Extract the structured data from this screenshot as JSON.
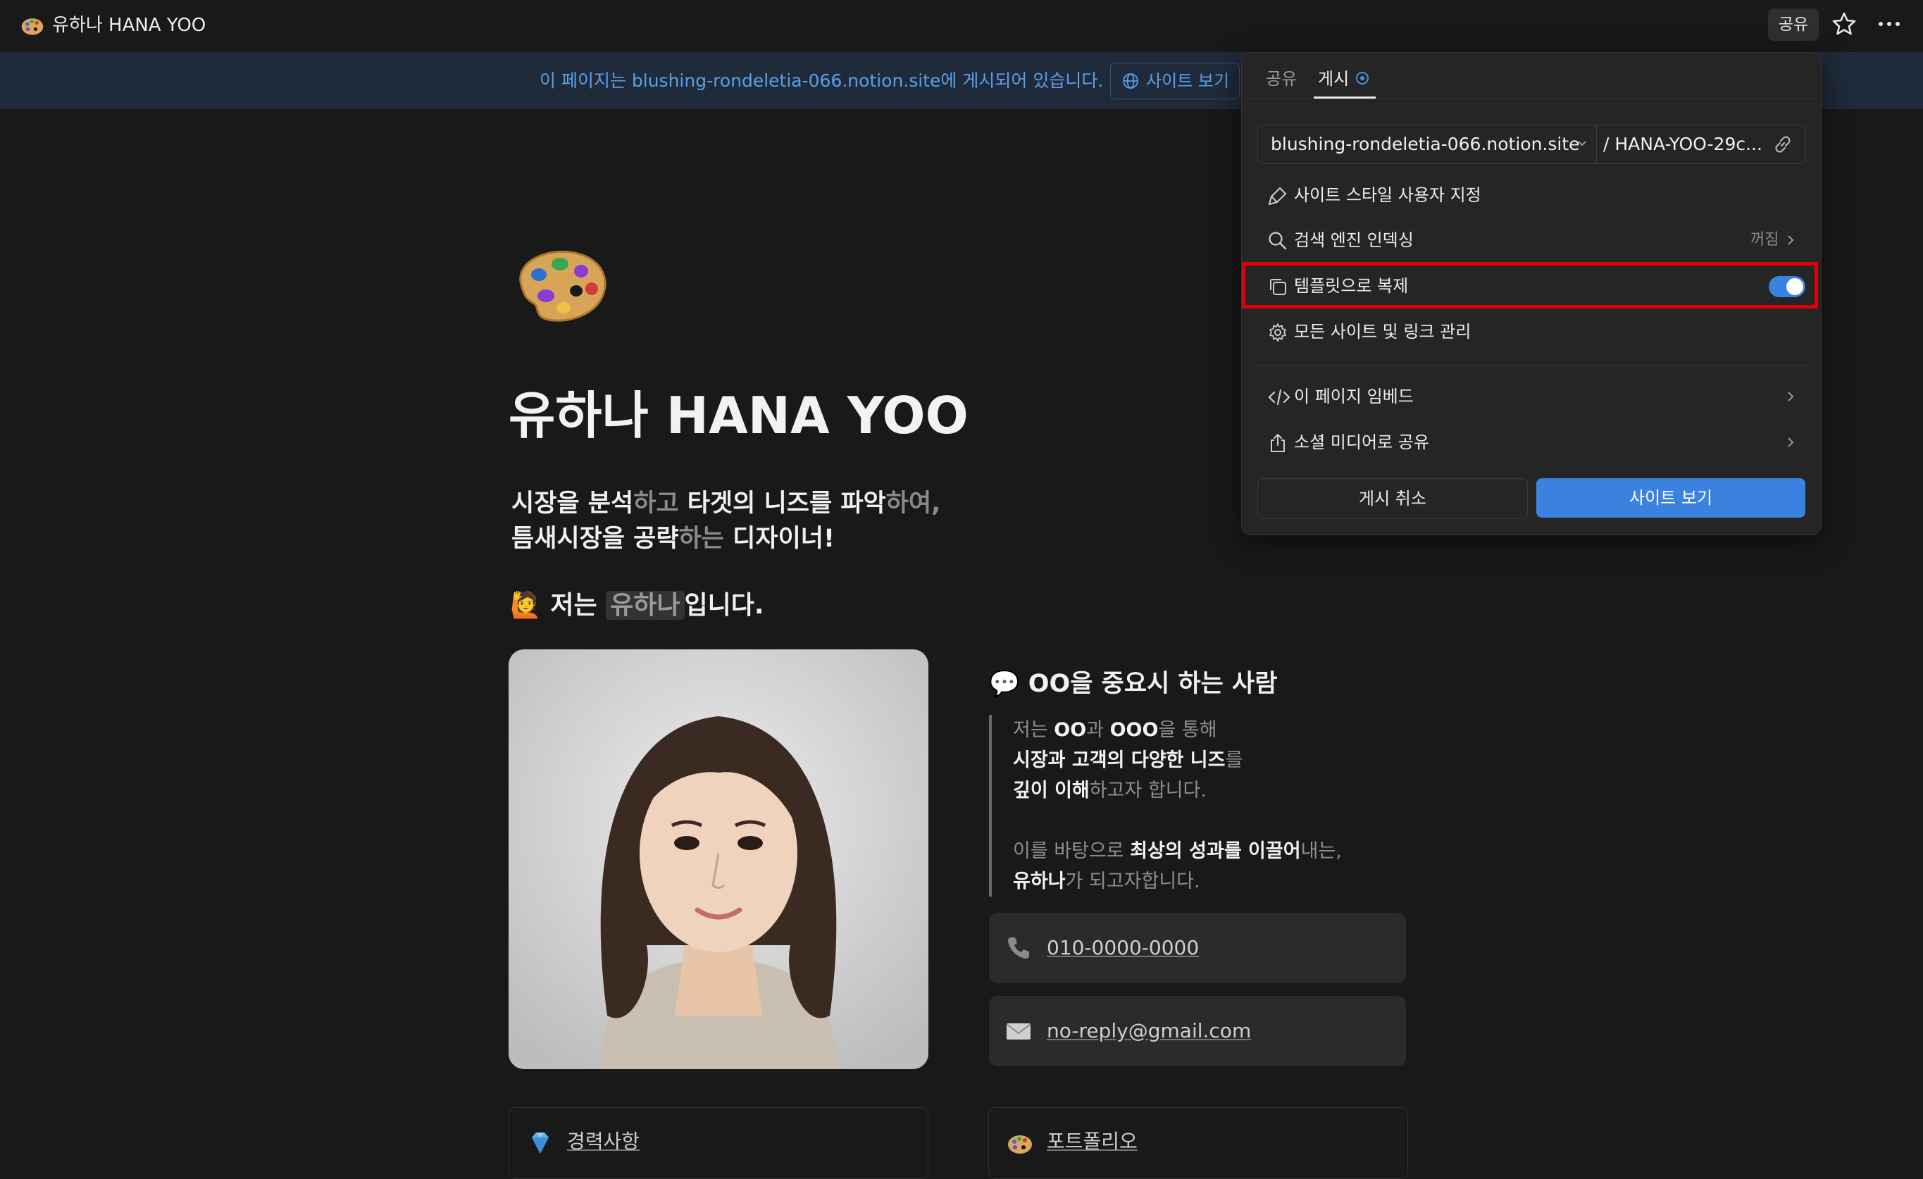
{
  "topbar": {
    "title": "유하나 HANA YOO",
    "share_label": "공유",
    "icons": [
      "palette-icon",
      "star-icon",
      "more-icon"
    ]
  },
  "banner": {
    "text": "이 페이지는 blushing-rondeletia-066.notion.site에 게시되어 있습니다.",
    "button_label": "사이트 보기"
  },
  "page": {
    "title": "유하나 HANA YOO",
    "tagline": {
      "line1": [
        {
          "t": "시장을 분석",
          "dim": false
        },
        {
          "t": "하고",
          "dim": true
        },
        {
          "t": " 타겟의 니즈를 파악",
          "dim": false
        },
        {
          "t": "하여,",
          "dim": true
        }
      ],
      "line2": [
        {
          "t": "틈새시장을 공략",
          "dim": false
        },
        {
          "t": "하는",
          "dim": true
        },
        {
          "t": " 디자이너!",
          "dim": false
        }
      ]
    },
    "intro": {
      "prefix": "저는",
      "name": "유하나",
      "suffix": "입니다."
    },
    "section_heading": "OO을 중요시 하는 사람",
    "quote": {
      "l1": [
        "저는 ",
        "OO",
        "과 ",
        "OOO",
        "을 통해"
      ],
      "l2": [
        "시장과 고객의 다양한 니즈",
        "를"
      ],
      "l3": [
        "깊이 이해",
        "하고자 합니다."
      ],
      "l4": [
        "이를 바탕으로 ",
        "최상의 성과를 이끌어",
        "내는,"
      ],
      "l5": [
        "유하나",
        "가 되고자합니다."
      ]
    },
    "phone": "010-0000-0000",
    "email": "no-reply@gmail.com",
    "links": [
      {
        "label": "경력사항",
        "icon": "gem-icon"
      },
      {
        "label": "포트폴리오",
        "icon": "palette-icon"
      }
    ]
  },
  "popover": {
    "tabs": [
      "공유",
      "게시"
    ],
    "active_tab": "게시",
    "domain": "blushing-rondeletia-066.notion.site",
    "slug": "/ HANA-YOO-29c...",
    "items": [
      {
        "label": "사이트 스타일 사용자 지정",
        "icon": "brush-icon"
      },
      {
        "label": "검색 엔진 인덱싱",
        "icon": "search-icon",
        "value": "꺼짐"
      },
      {
        "label": "템플릿으로 복제",
        "icon": "duplicate-icon",
        "toggle": true
      },
      {
        "label": "모든 사이트 및 링크 관리",
        "icon": "gear-icon"
      },
      {
        "label": "이 페이지 임베드",
        "icon": "code-icon"
      },
      {
        "label": "소셜 미디어로 공유",
        "icon": "share-icon"
      }
    ],
    "unpublish_label": "게시 취소",
    "view_site_label": "사이트 보기"
  },
  "colors": {
    "background": "#191919",
    "accent": "#3b82e0",
    "banner_text": "#5a9fe6",
    "highlight": "#e0000a"
  }
}
